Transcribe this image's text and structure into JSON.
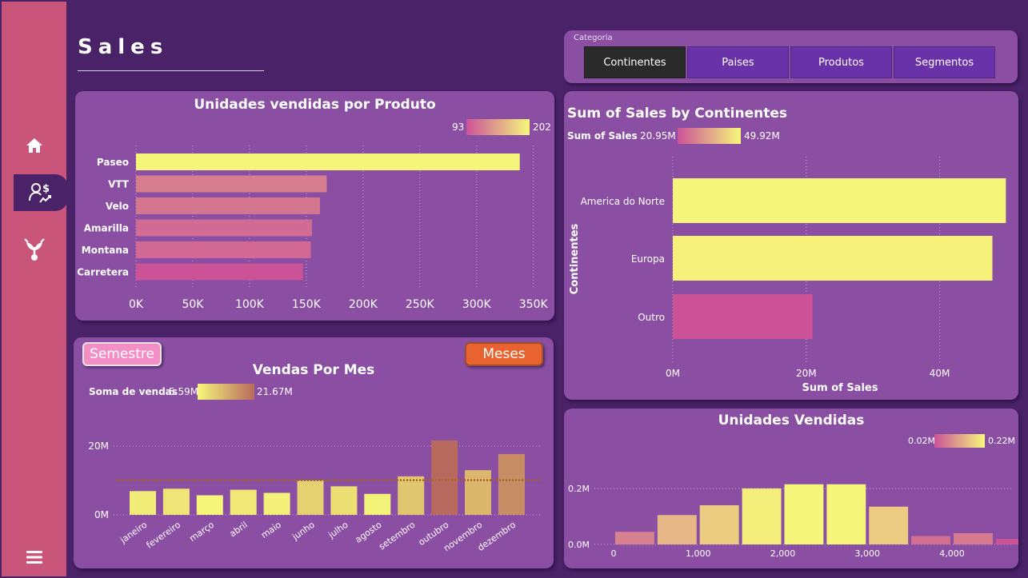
{
  "page": {
    "title": "Sales"
  },
  "sidebar": {
    "items": [
      {
        "icon": "home-icon"
      },
      {
        "icon": "user-dollar-icon"
      },
      {
        "icon": "plant-growth-icon"
      }
    ],
    "menu_icon": "hamburger-menu-icon"
  },
  "slicer": {
    "label": "Categoria",
    "options": [
      "Continentes",
      "Paises",
      "Produtos",
      "Segmentos"
    ],
    "selected": "Continentes"
  },
  "toggles": {
    "semestre": "Semestre",
    "meses": "Meses"
  },
  "colors": {
    "background": "#4a2268",
    "panel": "#8a4fa3",
    "sidebar": "#c9557a",
    "yellow": "#f6f77a",
    "pink": "#cc5298"
  },
  "chart_data": [
    {
      "type": "bar",
      "orientation": "horizontal",
      "title": "Unidades vendidas por Produto",
      "categories": [
        "Paseo",
        "VTT",
        "Velo",
        "Amarilla",
        "Montana",
        "Carretera"
      ],
      "values": [
        338000,
        168000,
        162000,
        155000,
        154000,
        147000
      ],
      "xticks": [
        "0K",
        "50K",
        "100K",
        "150K",
        "200K",
        "250K",
        "300K",
        "350K"
      ],
      "xlim": [
        0,
        365000
      ],
      "legend": {
        "min": "93",
        "max": "202"
      }
    },
    {
      "type": "bar",
      "orientation": "horizontal",
      "title": "Sum of Sales by Continentes",
      "categories": [
        "America do Norte",
        "Europa",
        "Outro"
      ],
      "values": [
        49.92,
        47.9,
        20.95
      ],
      "xticks": [
        "0M",
        "20M",
        "40M"
      ],
      "xlim": [
        0,
        50
      ],
      "xlabel": "Sum of Sales",
      "ylabel": "Continentes",
      "legend": {
        "label": "Sum of  Sales",
        "min": "20.95M",
        "max": "49.92M"
      }
    },
    {
      "type": "bar",
      "title": "Vendas Por Mes",
      "categories": [
        "janeiro",
        "fevereiro",
        "março",
        "abril",
        "maio",
        "junho",
        "julho",
        "agosto",
        "setembro",
        "outubro",
        "novembro",
        "dezembro"
      ],
      "values": [
        6.9,
        7.6,
        5.7,
        7.3,
        6.4,
        10.0,
        8.3,
        6.1,
        11.2,
        21.67,
        13.0,
        17.7
      ],
      "yticks": [
        "0M",
        "20M"
      ],
      "ylim": [
        0,
        24
      ],
      "average": 10.1,
      "legend": {
        "label": "Soma de vendas",
        "min": "5.59M",
        "max": "21.67M"
      }
    },
    {
      "type": "bar",
      "title": "Unidades Vendidas",
      "x": [
        500,
        1000,
        1500,
        2000,
        2500,
        3000,
        3500,
        4000
      ],
      "values": [
        0.045,
        0.105,
        0.14,
        0.2,
        0.215,
        0.215,
        0.135,
        0.03,
        0.04,
        0.02
      ],
      "bins": [
        [
          0,
          500
        ],
        [
          500,
          1000
        ],
        [
          1000,
          1500
        ],
        [
          1500,
          2000
        ],
        [
          2000,
          2500
        ],
        [
          2500,
          3000
        ],
        [
          3000,
          3500
        ],
        [
          3500,
          4000
        ],
        [
          4000,
          4500
        ],
        [
          4500,
          5000
        ]
      ],
      "xticks": [
        "0",
        "1,000",
        "2,000",
        "3,000",
        "4,000"
      ],
      "yticks": [
        "0.0M",
        "0.2M"
      ],
      "ylim": [
        0,
        0.27
      ],
      "legend": {
        "min": "0.02M",
        "max": "0.22M"
      }
    }
  ]
}
